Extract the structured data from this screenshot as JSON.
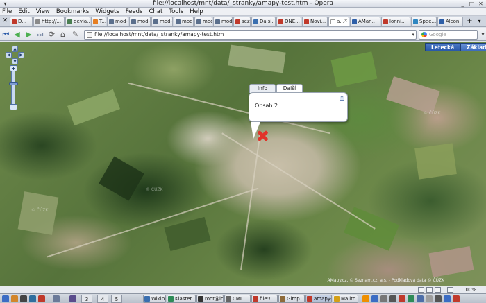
{
  "window": {
    "title": "file://localhost/mnt/data/_stranky/amapy-test.htm - Opera"
  },
  "menu": [
    "File",
    "Edit",
    "View",
    "Bookmarks",
    "Widgets",
    "Feeds",
    "Chat",
    "Tools",
    "Help"
  ],
  "tabs": [
    {
      "label": "D...",
      "color": "#c0392b"
    },
    {
      "label": "http://...",
      "color": "#8a8a8a"
    },
    {
      "label": "devia...",
      "color": "#4b7f52"
    },
    {
      "label": "T...",
      "color": "#e67e22"
    },
    {
      "label": "mod-...",
      "color": "#5b6f8c"
    },
    {
      "label": "mod-...",
      "color": "#5b6f8c"
    },
    {
      "label": "mod-...",
      "color": "#5b6f8c"
    },
    {
      "label": "sezn...",
      "color": "#c0392b"
    },
    {
      "label": "Další...",
      "color": "#3a6fb0"
    },
    {
      "label": "ONE...",
      "color": "#c0392b"
    },
    {
      "label": "Novi...",
      "color": "#c0392b"
    },
    {
      "label": "a...",
      "color": "#ffffff"
    },
    {
      "label": "AMar...",
      "color": "#2e5fa8"
    },
    {
      "label": "lonni...",
      "color": "#c0392b"
    },
    {
      "label": "Spee...",
      "color": "#2e86c1"
    },
    {
      "label": "Alcon",
      "color": "#2e5fa8"
    }
  ],
  "address": {
    "url": "file://localhost/mnt/data/_stranky/amapy-test.htm",
    "search_placeholder": "Google"
  },
  "map": {
    "layer_buttons": [
      "Letecká",
      "Základní"
    ],
    "popup": {
      "tabs": [
        "Info",
        "Další"
      ],
      "content": "Obsah 2"
    },
    "copyright": "AMapy.cz, © Seznam.cz, a.s. - Podkladová data © ČÚZK",
    "watermark": "© ČÚZK"
  },
  "status": {
    "zoom": "100%"
  },
  "taskbar": {
    "desktops": [
      "3",
      "4",
      "5"
    ],
    "tasks": [
      {
        "label": "Wikip...",
        "color": "#3a6fb0"
      },
      {
        "label": "Klaster",
        "color": "#2e8b57"
      },
      {
        "label": "root@loc...",
        "color": "#333333"
      },
      {
        "label": "CMI...",
        "color": "#666666"
      },
      {
        "label": "file:/...",
        "color": "#c0392b"
      },
      {
        "label": "Gimp",
        "color": "#8e6b3a"
      },
      {
        "label": "amapy-...",
        "color": "#c0392b"
      },
      {
        "label": "Mailto...",
        "color": "#d4a017"
      }
    ]
  }
}
